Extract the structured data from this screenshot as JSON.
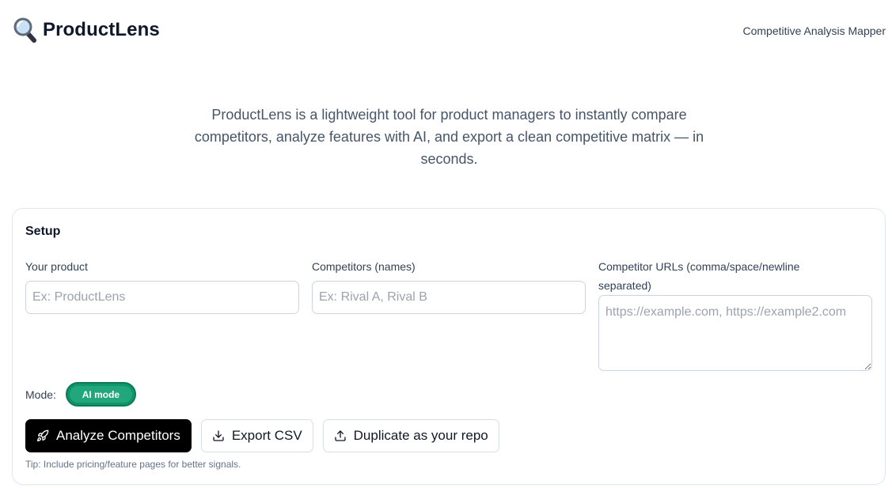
{
  "header": {
    "brand_icon": "magnifying-glass-icon",
    "title": "ProductLens",
    "subtitle": "Competitive Analysis Mapper"
  },
  "hero": {
    "description": "ProductLens is a lightweight tool for product managers to instantly compare competitors, analyze features with AI, and export a clean competitive matrix — in seconds."
  },
  "setup": {
    "title": "Setup",
    "product": {
      "label": "Your product",
      "value": "",
      "placeholder": "Ex: ProductLens"
    },
    "competitors": {
      "label": "Competitors (names)",
      "value": "",
      "placeholder": "Ex: Rival A, Rival B"
    },
    "urls": {
      "label": "Competitor URLs (comma/space/newline separated)",
      "value": "",
      "placeholder": "https://example.com, https://example2.com"
    },
    "mode": {
      "label": "Mode:",
      "value": "AI mode",
      "color": "#10946a"
    },
    "buttons": {
      "analyze": {
        "label": "Analyze Competitors",
        "icon": "rocket-icon"
      },
      "export": {
        "label": "Export CSV",
        "icon": "download-icon"
      },
      "duplicate": {
        "label": "Duplicate as your repo",
        "icon": "upload-icon"
      }
    },
    "tip": "Tip: Include pricing/feature pages for better signals."
  }
}
